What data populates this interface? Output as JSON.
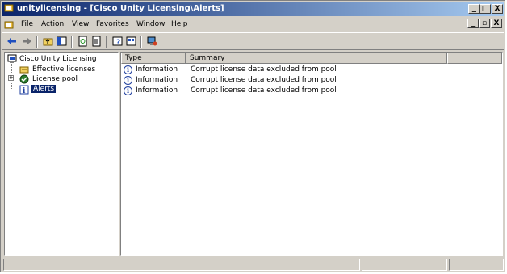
{
  "window": {
    "title": "unitylicensing - [Cisco Unity Licensing\\Alerts]",
    "controls": {
      "minimize": "_",
      "maximize": "□",
      "close": "X"
    }
  },
  "menubar": {
    "items": [
      {
        "label": "File"
      },
      {
        "label": "Action"
      },
      {
        "label": "View"
      },
      {
        "label": "Favorites"
      },
      {
        "label": "Window"
      },
      {
        "label": "Help"
      }
    ],
    "mdi_controls": {
      "minimize": "_",
      "restore": "▫",
      "close": "X"
    }
  },
  "toolbar": {
    "buttons": [
      "back-arrow-icon",
      "forward-arrow-icon",
      "up-folder-icon",
      "show-hide-tree-icon",
      "refresh-icon",
      "export-list-icon",
      "help-icon",
      "properties-icon",
      "connect-icon"
    ]
  },
  "tree": {
    "root": "Cisco Unity Licensing",
    "children": [
      {
        "label": "Effective licenses",
        "icon": "licenses-icon"
      },
      {
        "label": "License pool",
        "icon": "pool-icon",
        "expander": "+"
      },
      {
        "label": "Alerts",
        "icon": "alerts-icon",
        "selected": true
      }
    ]
  },
  "list": {
    "columns": [
      "Type",
      "Summary"
    ],
    "rows": [
      {
        "type": "Information",
        "summary": "Corrupt license data excluded from pool"
      },
      {
        "type": "Information",
        "summary": "Corrupt license data excluded from pool"
      },
      {
        "type": "Information",
        "summary": "Corrupt license data excluded from pool"
      }
    ]
  },
  "colors": {
    "title_active": "#0a246a",
    "selection": "#0a246a",
    "face": "#d4d0c8"
  }
}
